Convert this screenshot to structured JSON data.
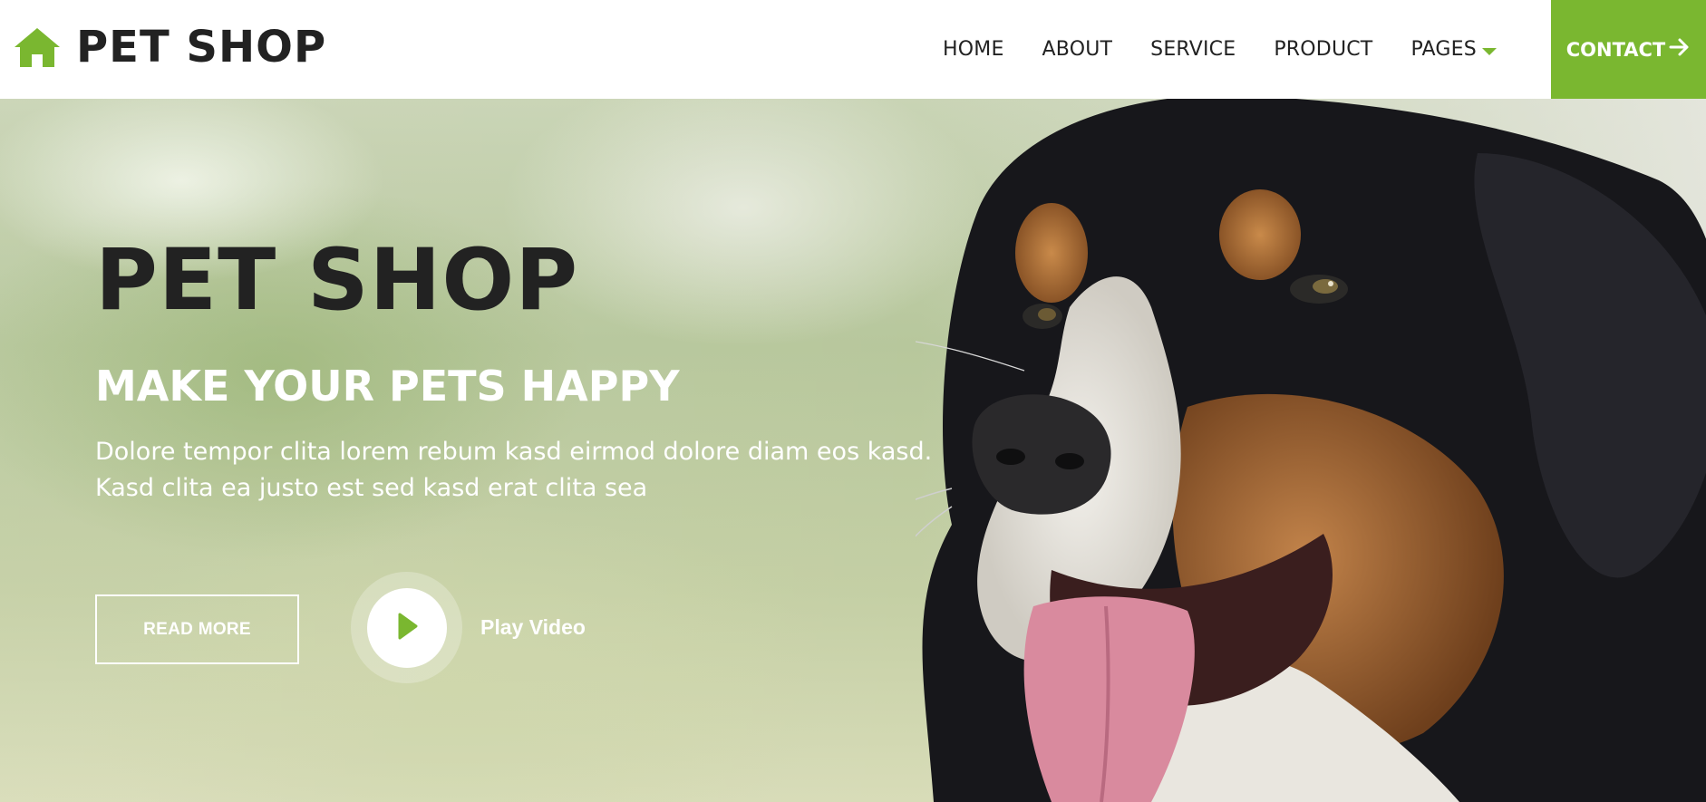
{
  "colors": {
    "accent": "#7ab730",
    "dark": "#222222",
    "white": "#ffffff"
  },
  "brand": {
    "icon": "home-icon",
    "name": "PET SHOP"
  },
  "nav": {
    "items": [
      {
        "label": "HOME"
      },
      {
        "label": "ABOUT"
      },
      {
        "label": "SERVICE"
      },
      {
        "label": "PRODUCT"
      },
      {
        "label": "PAGES",
        "icon": "caret-down-icon"
      }
    ],
    "contact": {
      "label": "CONTACT",
      "icon": "arrow-right-icon"
    }
  },
  "hero": {
    "title": "PET SHOP",
    "subtitle": "MAKE YOUR PETS HAPPY",
    "description_lines": [
      "Dolore tempor clita lorem rebum kasd eirmod dolore diam eos kasd.",
      "Kasd clita ea justo est sed kasd erat clita sea"
    ],
    "read_more": "READ MORE",
    "play_icon": "play-icon",
    "play_label": "Play Video"
  }
}
